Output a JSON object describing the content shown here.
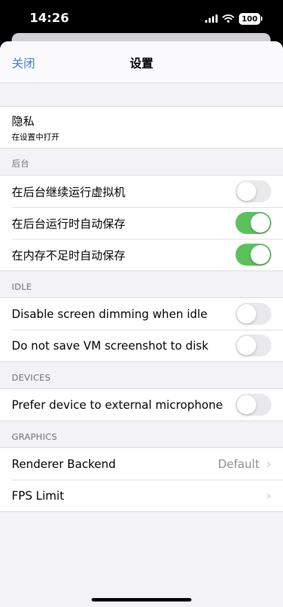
{
  "status_bar": {
    "time": "14:26",
    "battery": "100",
    "icons": [
      "signal-icon",
      "wifi-icon",
      "battery-icon"
    ]
  },
  "navbar": {
    "close_label": "关闭",
    "title": "设置"
  },
  "privacy": {
    "title": "隐私",
    "subtitle": "在设置中打开"
  },
  "sections": {
    "background": {
      "header": "后台",
      "rows": [
        {
          "label": "在后台继续运行虚拟机",
          "on": false
        },
        {
          "label": "在后台运行时自动保存",
          "on": true
        },
        {
          "label": "在内存不足时自动保存",
          "on": true
        }
      ]
    },
    "idle": {
      "header": "IDLE",
      "rows": [
        {
          "label": "Disable screen dimming when idle",
          "on": false
        },
        {
          "label": "Do not save VM screenshot to disk",
          "on": false
        }
      ]
    },
    "devices": {
      "header": "DEVICES",
      "rows": [
        {
          "label": "Prefer device to external microphone",
          "on": false
        }
      ]
    },
    "graphics": {
      "header": "GRAPHICS",
      "renderer_label": "Renderer Backend",
      "renderer_value": "Default",
      "fps_label": "FPS Limit"
    }
  },
  "colors": {
    "accent": "#3c78d8",
    "toggle_on": "#5ac15c",
    "toggle_off": "#e9e9eb",
    "background": "#f2f2f7"
  }
}
